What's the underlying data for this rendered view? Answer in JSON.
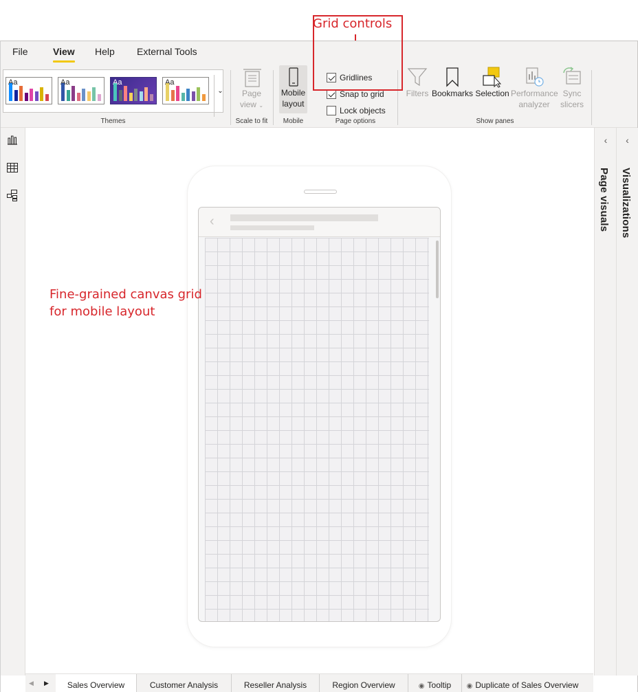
{
  "callouts": {
    "grid_controls": "Grid controls",
    "canvas_note": "Fine-grained canvas grid for mobile layout"
  },
  "menu": {
    "items": [
      {
        "label": "File",
        "active": false
      },
      {
        "label": "View",
        "active": true
      },
      {
        "label": "Help",
        "active": false
      },
      {
        "label": "External Tools",
        "active": false
      }
    ]
  },
  "ribbon": {
    "themes": {
      "group_label": "Themes",
      "swatch_text": "Aa",
      "items": [
        {
          "name": "theme-1",
          "colors": [
            "#118dff",
            "#12239e",
            "#e66c37",
            "#6b007b",
            "#e044a7",
            "#744ec2",
            "#d9b300",
            "#d64550"
          ]
        },
        {
          "name": "theme-2",
          "colors": [
            "#3257a8",
            "#37a794",
            "#8b3d88",
            "#dd6b7f",
            "#6b91c9",
            "#f5c869",
            "#77c4a8",
            "#dea6cf"
          ]
        },
        {
          "name": "theme-3",
          "colors": [
            "#4ac5bb",
            "#5f6b6d",
            "#fb8281",
            "#f4d25a",
            "#7f898a",
            "#a4ddee",
            "#fdab89",
            "#b687ac"
          ]
        },
        {
          "name": "theme-4",
          "colors": [
            "#e8d166",
            "#e6744b",
            "#e9458c",
            "#57b6a8",
            "#3d84c6",
            "#7b51a8",
            "#9bc25b",
            "#f09a3e"
          ]
        }
      ]
    },
    "scale_to_fit": {
      "label_line1": "Page",
      "label_line2": "view",
      "group_label": "Scale to fit"
    },
    "mobile": {
      "label_line1": "Mobile",
      "label_line2": "layout",
      "group_label": "Mobile"
    },
    "page_options": {
      "group_label": "Page options",
      "checkboxes": [
        {
          "label": "Gridlines",
          "checked": true
        },
        {
          "label": "Snap to grid",
          "checked": true
        },
        {
          "label": "Lock objects",
          "checked": false
        }
      ]
    },
    "show_panes": {
      "group_label": "Show panes",
      "filters": "Filters",
      "bookmarks": "Bookmarks",
      "selection": "Selection",
      "performance_line1": "Performance",
      "performance_line2": "analyzer",
      "sync_line1": "Sync",
      "sync_line2": "slicers"
    }
  },
  "panes": {
    "page_visuals": "Page visuals",
    "visualizations": "Visualizations"
  },
  "tabs": {
    "items": [
      {
        "label": "Sales Overview",
        "active": true
      },
      {
        "label": "Customer Analysis",
        "active": false
      },
      {
        "label": "Reseller Analysis",
        "active": false
      },
      {
        "label": "Region Overview",
        "active": false
      },
      {
        "label": "Tooltip",
        "active": false,
        "hidden_icon": true
      },
      {
        "label": "Duplicate of Sales Overview",
        "active": false,
        "hidden_icon": true
      }
    ]
  },
  "colors": {
    "accent": "#f2c811",
    "callout_red": "#d7262b"
  }
}
